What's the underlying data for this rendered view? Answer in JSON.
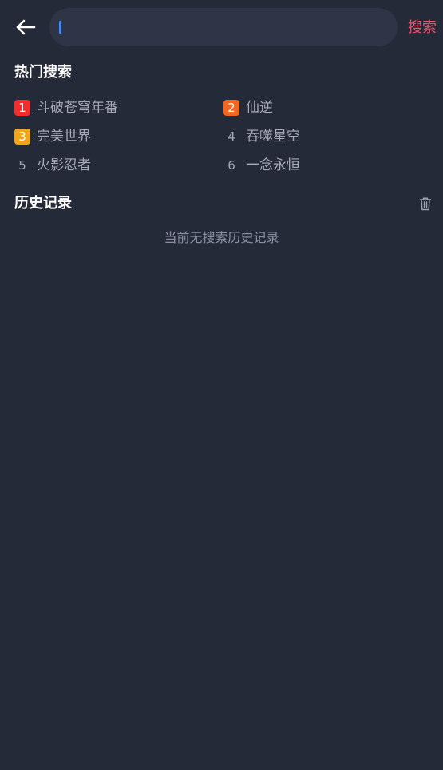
{
  "search": {
    "value": "",
    "placeholder": "",
    "button_label": "搜索"
  },
  "hot_search": {
    "title": "热门搜索",
    "items": [
      {
        "rank": "1",
        "label": "斗破苍穹年番",
        "badge_color": "#f22d2d"
      },
      {
        "rank": "2",
        "label": "仙逆",
        "badge_color": "#f2661f"
      },
      {
        "rank": "3",
        "label": "完美世界",
        "badge_color": "#f0a61c"
      },
      {
        "rank": "4",
        "label": "吞噬星空",
        "badge_color": ""
      },
      {
        "rank": "5",
        "label": "火影忍者",
        "badge_color": ""
      },
      {
        "rank": "6",
        "label": "一念永恒",
        "badge_color": ""
      }
    ]
  },
  "history": {
    "title": "历史记录",
    "empty_text": "当前无搜索历史记录"
  },
  "icons": {
    "back": "arrow-left-icon",
    "clear_history": "trash-icon"
  },
  "colors": {
    "background": "#252a38",
    "search_box": "#2f3447",
    "accent": "#ee4e6b",
    "caret": "#3b8cff"
  }
}
